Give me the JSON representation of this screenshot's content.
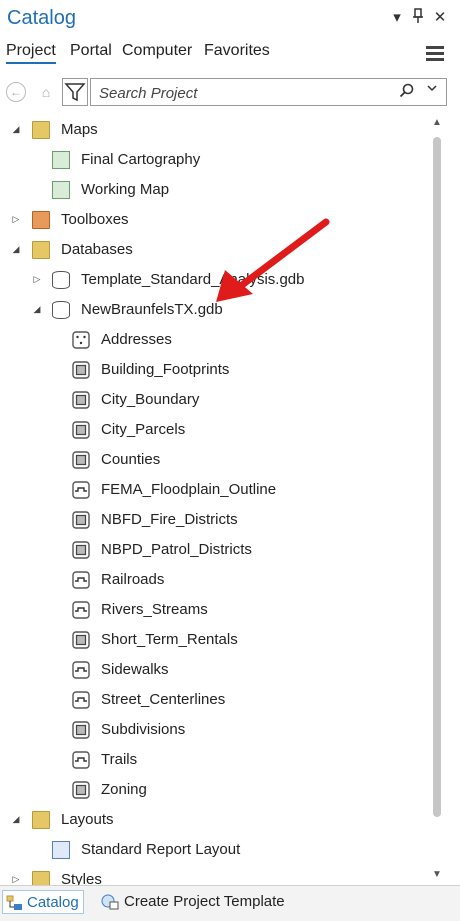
{
  "pane": {
    "title": "Catalog",
    "controls": {
      "dropdown": "▾",
      "pin": "📌",
      "close": "✕"
    }
  },
  "tabs": [
    "Project",
    "Portal",
    "Computer",
    "Favorites"
  ],
  "active_tab": "Project",
  "search": {
    "placeholder": "Search Project"
  },
  "tree": {
    "maps_label": "Maps",
    "maps": [
      "Final Cartography",
      "Working Map"
    ],
    "toolboxes_label": "Toolboxes",
    "databases_label": "Databases",
    "gdb1": "Template_Standard_Analysis.gdb",
    "gdb2": "NewBraunfelsTX.gdb",
    "feature_classes": [
      {
        "name": "Addresses",
        "type": "point"
      },
      {
        "name": "Building_Footprints",
        "type": "polygon"
      },
      {
        "name": "City_Boundary",
        "type": "polygon"
      },
      {
        "name": "City_Parcels",
        "type": "polygon"
      },
      {
        "name": "Counties",
        "type": "polygon"
      },
      {
        "name": "FEMA_Floodplain_Outline",
        "type": "line"
      },
      {
        "name": "NBFD_Fire_Districts",
        "type": "polygon"
      },
      {
        "name": "NBPD_Patrol_Districts",
        "type": "polygon"
      },
      {
        "name": "Railroads",
        "type": "line"
      },
      {
        "name": "Rivers_Streams",
        "type": "line"
      },
      {
        "name": "Short_Term_Rentals",
        "type": "polygon"
      },
      {
        "name": "Sidewalks",
        "type": "line"
      },
      {
        "name": "Street_Centerlines",
        "type": "line"
      },
      {
        "name": "Subdivisions",
        "type": "polygon"
      },
      {
        "name": "Trails",
        "type": "line"
      },
      {
        "name": "Zoning",
        "type": "polygon"
      }
    ],
    "layouts_label": "Layouts",
    "layouts": [
      "Standard Report Layout"
    ],
    "styles_label": "Styles"
  },
  "bottom_tabs": {
    "catalog": "Catalog",
    "template": "Create Project Template"
  },
  "colors": {
    "accent": "#1f6fb5",
    "annotation_arrow": "#e01b1b"
  }
}
